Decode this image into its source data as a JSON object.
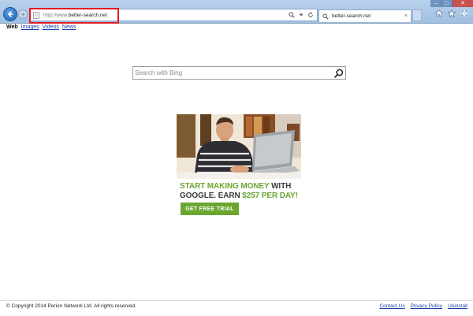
{
  "browser": {
    "address_scheme": "http://www.",
    "address_host": "better-search.net",
    "tab_title": "better-search.net",
    "tab_close": "×",
    "window_min": "–",
    "window_max": "□",
    "window_close": "✕"
  },
  "nav": {
    "items": [
      {
        "label": "Web"
      },
      {
        "label": "Images"
      },
      {
        "label": "Videos"
      },
      {
        "label": "News"
      }
    ]
  },
  "search": {
    "placeholder": "Search with Bing"
  },
  "ad": {
    "line1_green": "START MAKING MONEY",
    "line1_rest": " WITH",
    "line2_start": "GOOGLE. EARN ",
    "line2_green": "$257 PER DAY!",
    "cta": "GET FREE TRIAL"
  },
  "footer": {
    "copyright": "© Copyright 2014 Perion Network Ltd. All rights reserved.",
    "links": [
      {
        "label": "Contact Us"
      },
      {
        "label": "Privacy Policy"
      },
      {
        "label": "Uninstall"
      }
    ]
  },
  "colors": {
    "highlight": "#e01b24",
    "ad_green": "#6aa630",
    "link": "#1a3fa8"
  },
  "icons": {
    "back": "arrow-left-icon",
    "forward": "arrow-right-icon",
    "page": "page-icon",
    "search": "magnifier-icon",
    "refresh": "refresh-icon",
    "home": "home-icon",
    "favorites": "star-icon",
    "tools": "gear-icon"
  }
}
